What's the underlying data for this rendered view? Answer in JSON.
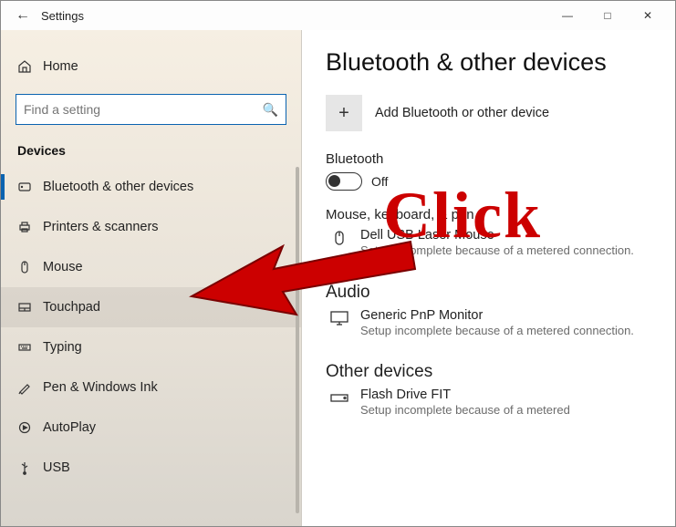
{
  "window": {
    "title": "Settings"
  },
  "sidebar": {
    "home": "Home",
    "search_placeholder": "Find a setting",
    "section": "Devices",
    "items": [
      {
        "label": "Bluetooth & other devices"
      },
      {
        "label": "Printers & scanners"
      },
      {
        "label": "Mouse"
      },
      {
        "label": "Touchpad"
      },
      {
        "label": "Typing"
      },
      {
        "label": "Pen & Windows Ink"
      },
      {
        "label": "AutoPlay"
      },
      {
        "label": "USB"
      }
    ]
  },
  "content": {
    "heading": "Bluetooth & other devices",
    "add_label": "Add Bluetooth or other device",
    "bluetooth": {
      "header": "Bluetooth",
      "state": "Off"
    },
    "mouse_section": {
      "header": "Mouse, keyboard, & pen",
      "device": "Dell USB Laser Mouse",
      "sub": "Setup incomplete because of a metered connection."
    },
    "audio_section": {
      "header": "Audio",
      "device": "Generic PnP Monitor",
      "sub": "Setup incomplete because of a metered connection."
    },
    "other_section": {
      "header": "Other devices",
      "device": "Flash Drive FIT",
      "sub": "Setup incomplete because of a metered"
    }
  },
  "annotation": {
    "text": "Click"
  }
}
